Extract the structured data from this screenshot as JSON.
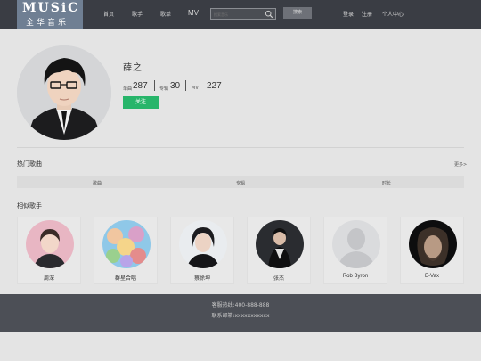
{
  "header": {
    "logo_text": "MUSiC",
    "logo_subtitle": "全华音乐",
    "nav": [
      "首页",
      "歌手",
      "歌单",
      "MV"
    ],
    "search_placeholder": "搜索音乐",
    "search_button": "搜索",
    "right_links": [
      "登录",
      "注册",
      "个人中心"
    ]
  },
  "artist": {
    "name": "薛之",
    "stats": [
      {
        "label": "单曲",
        "value": "287"
      },
      {
        "label": "专辑",
        "value": "30"
      },
      {
        "label": "MV",
        "value": "227"
      }
    ],
    "follow_button": "关注"
  },
  "songs": {
    "title": "热门歌曲",
    "more": "更多>",
    "columns": [
      "歌曲",
      "专辑",
      "时长"
    ]
  },
  "similar": {
    "title": "相似歌手",
    "artists": [
      "周深",
      "群星合唱",
      "蔡徐坤",
      "张杰",
      "Rob Byron",
      "E-Vax"
    ]
  },
  "footer": {
    "line1": "客服热线:400-888-888",
    "line2": "联系邮箱:xxxxxxxxxxx"
  },
  "colors": {
    "header_bg": "#3a3d44",
    "follow_green": "#27b56a",
    "footer_bg": "#4c4f56"
  }
}
